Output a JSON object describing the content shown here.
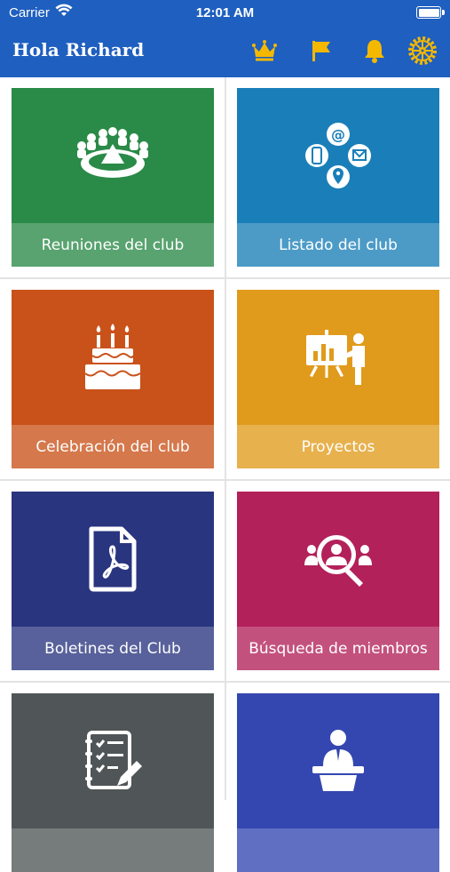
{
  "status_bar": {
    "carrier": "Carrier",
    "time": "12:01 AM"
  },
  "header": {
    "title": "Hola Richard",
    "icons": [
      "crown-icon",
      "flag-icon",
      "bell-icon",
      "rotary-wheel-icon"
    ],
    "accent": "#f5b800"
  },
  "tiles": [
    {
      "label": "Reuniones del club",
      "icon": "meeting-table-icon",
      "color": "#2a8a47"
    },
    {
      "label": "Listado del club",
      "icon": "contacts-icon",
      "color": "#1a7fb8"
    },
    {
      "label": "Celebración del club",
      "icon": "cake-icon",
      "color": "#c9521a"
    },
    {
      "label": "Proyectos",
      "icon": "presentation-icon",
      "color": "#e09b1c"
    },
    {
      "label": "Boletines del Club",
      "icon": "pdf-document-icon",
      "color": "#2a357f"
    },
    {
      "label": "Búsqueda de miembros",
      "icon": "member-search-icon",
      "color": "#b3215a"
    },
    {
      "label": "",
      "icon": "checklist-icon",
      "color": "#505657"
    },
    {
      "label": "",
      "icon": "speaker-podium-icon",
      "color": "#3447b0"
    }
  ]
}
